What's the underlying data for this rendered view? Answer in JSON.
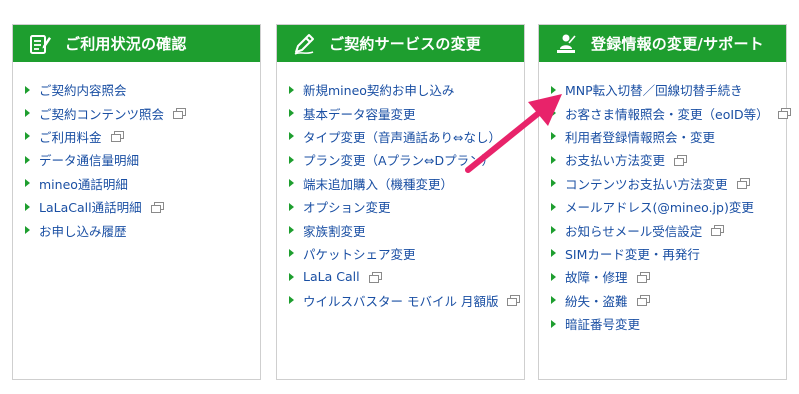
{
  "colors": {
    "header_green": "#1e9e2f",
    "link_blue": "#1a4fa3",
    "annotation_arrow": "#e8236a"
  },
  "panels": [
    {
      "title": "ご利用状況の確認",
      "icon": "document-edit-icon",
      "items": [
        {
          "label": "ご契約内容照会",
          "external": false
        },
        {
          "label": "ご契約コンテンツ照会",
          "external": true
        },
        {
          "label": "ご利用料金",
          "external": true
        },
        {
          "label": "データ通信量明細",
          "external": false
        },
        {
          "label": "mineo通話明細",
          "external": false
        },
        {
          "label": "LaLaCall通話明細",
          "external": true
        },
        {
          "label": "お申し込み履歴",
          "external": false
        }
      ]
    },
    {
      "title": "ご契約サービスの変更",
      "icon": "pencil-icon",
      "items": [
        {
          "label": "新規mineo契約お申し込み",
          "external": false
        },
        {
          "label": "基本データ容量変更",
          "external": false
        },
        {
          "label": "タイプ変更（音声通話あり⇔なし）",
          "external": false
        },
        {
          "label": "プラン変更（Aプラン⇔Dプラン）",
          "external": false
        },
        {
          "label": "端末追加購入（機種変更）",
          "external": false
        },
        {
          "label": "オプション変更",
          "external": false
        },
        {
          "label": "家族割変更",
          "external": false
        },
        {
          "label": "パケットシェア変更",
          "external": false
        },
        {
          "label": "LaLa Call",
          "external": true
        },
        {
          "label": "ウイルスバスター モバイル 月額版",
          "external": true
        }
      ]
    },
    {
      "title": "登録情報の変更/サポート",
      "icon": "user-support-icon",
      "items": [
        {
          "label": "MNP転入切替／回線切替手続き",
          "external": false
        },
        {
          "label": "お客さま情報照会・変更（eoID等）",
          "external": true
        },
        {
          "label": "利用者登録情報照会・変更",
          "external": false
        },
        {
          "label": "お支払い方法変更",
          "external": true
        },
        {
          "label": "コンテンツお支払い方法変更",
          "external": true
        },
        {
          "label": "メールアドレス(@mineo.jp)変更",
          "external": false
        },
        {
          "label": "お知らせメール受信設定",
          "external": true
        },
        {
          "label": "SIMカード変更・再発行",
          "external": false
        },
        {
          "label": "故障・修理",
          "external": true
        },
        {
          "label": "紛失・盗難",
          "external": true
        },
        {
          "label": "暗証番号変更",
          "external": false
        }
      ]
    }
  ]
}
